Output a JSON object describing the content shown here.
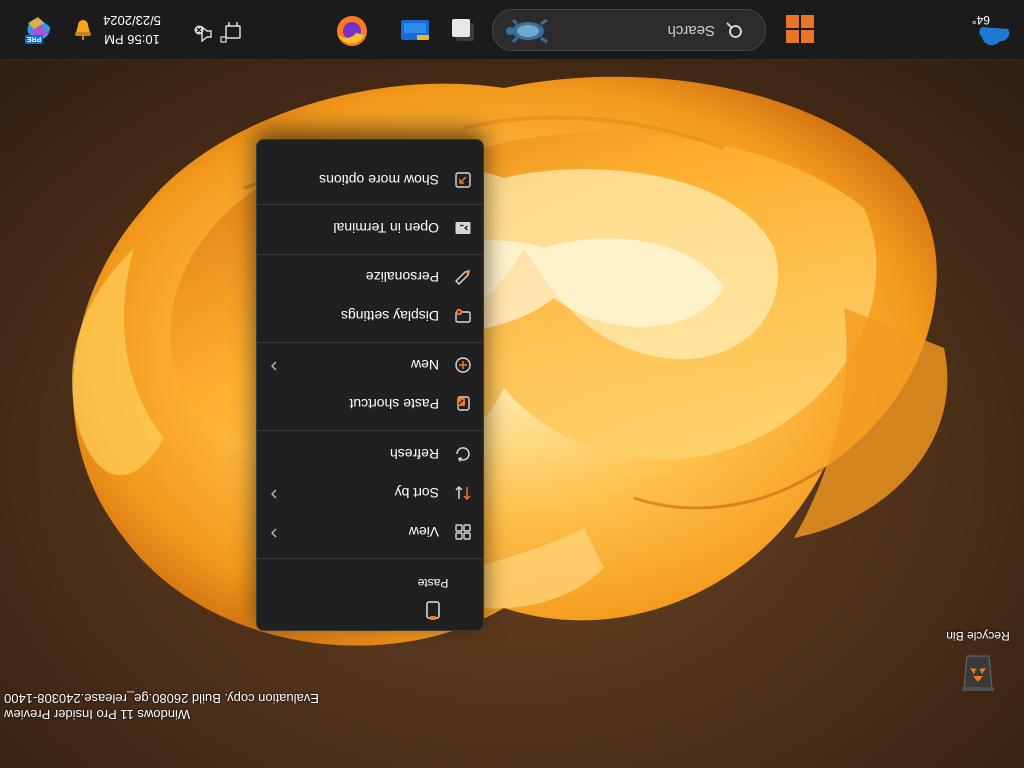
{
  "desktop": {
    "icons": [
      {
        "label": "Recycle Bin",
        "icon": "recycle-bin-icon"
      }
    ],
    "watermark": {
      "line1": "Windows 11 Pro Insider Preview",
      "line2": "Evaluation copy. Build 26080.ge_release.240308-1400"
    }
  },
  "context_menu": {
    "paste_label": "Paste",
    "items": [
      {
        "label": "View",
        "icon": "view-grid-icon",
        "submenu": true
      },
      {
        "label": "Sort by",
        "icon": "sort-icon",
        "submenu": true
      },
      {
        "label": "Refresh",
        "icon": "refresh-icon",
        "submenu": false
      },
      {
        "label": "Paste shortcut",
        "icon": "paste-shortcut-icon",
        "submenu": false
      },
      {
        "label": "New",
        "icon": "new-plus-icon",
        "submenu": true
      },
      {
        "label": "Display settings",
        "icon": "display-settings-icon",
        "submenu": false
      },
      {
        "label": "Personalize",
        "icon": "personalize-pen-icon",
        "submenu": false
      },
      {
        "label": "Open in Terminal",
        "icon": "terminal-icon",
        "submenu": false
      },
      {
        "label": "Show more options",
        "icon": "show-more-options-icon",
        "submenu": false
      }
    ]
  },
  "taskbar": {
    "weather_temp": "64°",
    "search_placeholder": "Search",
    "pinned": [
      "start-icon",
      "search-icon",
      "task-view-icon",
      "file-explorer-icon",
      "firefox-icon"
    ],
    "tray": {
      "time": "10:56 PM",
      "date": "5/23/2024"
    },
    "copilot_badge": "PRE"
  },
  "colors": {
    "accent_orange": "#f47a1f",
    "menu_bg": "#202020",
    "taskbar_bg": "#1b1b1b",
    "start_orange": "#e8742a"
  }
}
